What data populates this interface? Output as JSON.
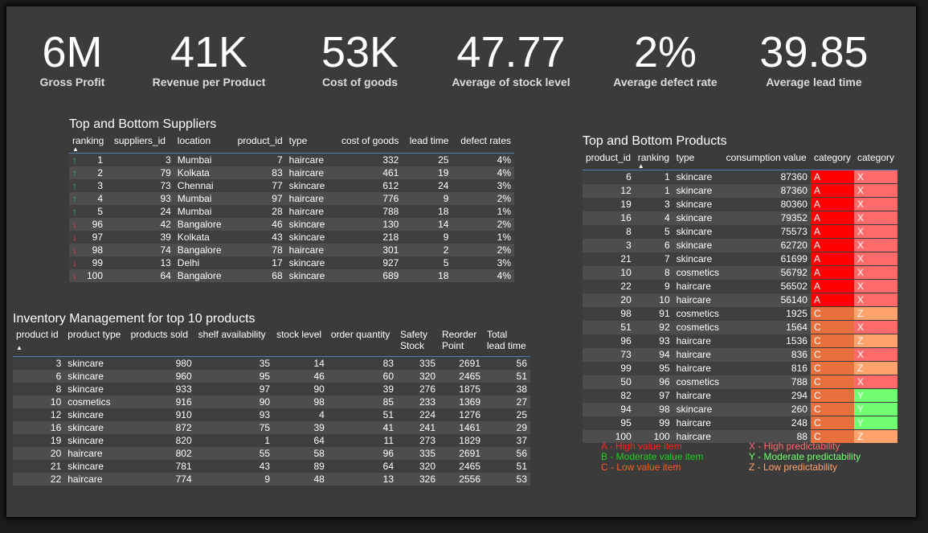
{
  "kpis": [
    {
      "value": "6M",
      "label": "Gross Profit"
    },
    {
      "value": "41K",
      "label": "Revenue per Product"
    },
    {
      "value": "53K",
      "label": "Cost of goods"
    },
    {
      "value": "47.77",
      "label": "Average of stock level"
    },
    {
      "value": "2%",
      "label": "Average defect rate"
    },
    {
      "value": "39.85",
      "label": "Average lead time"
    }
  ],
  "suppliers": {
    "title": "Top and Bottom Suppliers",
    "columns": [
      "ranking",
      "suppliers_id",
      "location",
      "product_id",
      "type",
      "cost of goods",
      "lead time",
      "defect rates"
    ],
    "rows": [
      {
        "dir": "up",
        "ranking": "1",
        "supplier": "3",
        "location": "Mumbai",
        "product": "7",
        "type": "haircare",
        "cost": "332",
        "lead": "25",
        "defect": "4%"
      },
      {
        "dir": "up",
        "ranking": "2",
        "supplier": "79",
        "location": "Kolkata",
        "product": "83",
        "type": "haircare",
        "cost": "461",
        "lead": "19",
        "defect": "4%"
      },
      {
        "dir": "up",
        "ranking": "3",
        "supplier": "73",
        "location": "Chennai",
        "product": "77",
        "type": "skincare",
        "cost": "612",
        "lead": "24",
        "defect": "3%"
      },
      {
        "dir": "up",
        "ranking": "4",
        "supplier": "93",
        "location": "Mumbai",
        "product": "97",
        "type": "haircare",
        "cost": "776",
        "lead": "9",
        "defect": "2%"
      },
      {
        "dir": "up",
        "ranking": "5",
        "supplier": "24",
        "location": "Mumbai",
        "product": "28",
        "type": "haircare",
        "cost": "788",
        "lead": "18",
        "defect": "1%"
      },
      {
        "dir": "down",
        "ranking": "96",
        "supplier": "42",
        "location": "Bangalore",
        "product": "46",
        "type": "skincare",
        "cost": "130",
        "lead": "14",
        "defect": "2%"
      },
      {
        "dir": "down",
        "ranking": "97",
        "supplier": "39",
        "location": "Kolkata",
        "product": "43",
        "type": "skincare",
        "cost": "218",
        "lead": "9",
        "defect": "1%"
      },
      {
        "dir": "down",
        "ranking": "98",
        "supplier": "74",
        "location": "Bangalore",
        "product": "78",
        "type": "haircare",
        "cost": "301",
        "lead": "2",
        "defect": "2%"
      },
      {
        "dir": "down",
        "ranking": "99",
        "supplier": "13",
        "location": "Delhi",
        "product": "17",
        "type": "skincare",
        "cost": "927",
        "lead": "5",
        "defect": "3%"
      },
      {
        "dir": "down",
        "ranking": "100",
        "supplier": "64",
        "location": "Bangalore",
        "product": "68",
        "type": "skincare",
        "cost": "689",
        "lead": "18",
        "defect": "4%"
      }
    ]
  },
  "inventory": {
    "title": "Inventory Management for top 10 products",
    "columns": [
      "product id",
      "product type",
      "products sold",
      "shelf availability",
      "stock level",
      "order quantity",
      "Safety Stock",
      "Reorder Point",
      "Total lead time"
    ],
    "rows": [
      [
        "3",
        "skincare",
        "980",
        "35",
        "14",
        "83",
        "335",
        "2691",
        "56"
      ],
      [
        "6",
        "skincare",
        "960",
        "95",
        "46",
        "60",
        "320",
        "2465",
        "51"
      ],
      [
        "8",
        "skincare",
        "933",
        "97",
        "90",
        "39",
        "276",
        "1875",
        "38"
      ],
      [
        "10",
        "cosmetics",
        "916",
        "90",
        "98",
        "85",
        "233",
        "1369",
        "27"
      ],
      [
        "12",
        "skincare",
        "910",
        "93",
        "4",
        "51",
        "224",
        "1276",
        "25"
      ],
      [
        "16",
        "skincare",
        "872",
        "75",
        "39",
        "41",
        "241",
        "1461",
        "29"
      ],
      [
        "19",
        "skincare",
        "820",
        "1",
        "64",
        "11",
        "273",
        "1829",
        "37"
      ],
      [
        "20",
        "haircare",
        "802",
        "55",
        "58",
        "96",
        "335",
        "2691",
        "56"
      ],
      [
        "21",
        "skincare",
        "781",
        "43",
        "89",
        "64",
        "320",
        "2465",
        "51"
      ],
      [
        "22",
        "haircare",
        "774",
        "9",
        "48",
        "13",
        "326",
        "2556",
        "53"
      ]
    ]
  },
  "products": {
    "title": "Top and Bottom Products",
    "columns": [
      "product_id",
      "ranking",
      "type",
      "consumption value",
      "category",
      "category"
    ],
    "rows": [
      [
        "6",
        "1",
        "skincare",
        "87360",
        "A",
        "X"
      ],
      [
        "12",
        "1",
        "skincare",
        "87360",
        "A",
        "X"
      ],
      [
        "19",
        "3",
        "skincare",
        "80360",
        "A",
        "X"
      ],
      [
        "16",
        "4",
        "skincare",
        "79352",
        "A",
        "X"
      ],
      [
        "8",
        "5",
        "skincare",
        "75573",
        "A",
        "X"
      ],
      [
        "3",
        "6",
        "skincare",
        "62720",
        "A",
        "X"
      ],
      [
        "21",
        "7",
        "skincare",
        "61699",
        "A",
        "X"
      ],
      [
        "10",
        "8",
        "cosmetics",
        "56792",
        "A",
        "X"
      ],
      [
        "22",
        "9",
        "haircare",
        "56502",
        "A",
        "X"
      ],
      [
        "20",
        "10",
        "haircare",
        "56140",
        "A",
        "X"
      ],
      [
        "98",
        "91",
        "cosmetics",
        "1925",
        "C",
        "Z"
      ],
      [
        "51",
        "92",
        "cosmetics",
        "1564",
        "C",
        "X"
      ],
      [
        "96",
        "93",
        "haircare",
        "1536",
        "C",
        "Z"
      ],
      [
        "73",
        "94",
        "haircare",
        "836",
        "C",
        "X"
      ],
      [
        "99",
        "95",
        "haircare",
        "816",
        "C",
        "Z"
      ],
      [
        "50",
        "96",
        "cosmetics",
        "788",
        "C",
        "X"
      ],
      [
        "82",
        "97",
        "haircare",
        "294",
        "C",
        "Y"
      ],
      [
        "94",
        "98",
        "skincare",
        "260",
        "C",
        "Y"
      ],
      [
        "95",
        "99",
        "haircare",
        "248",
        "C",
        "Y"
      ],
      [
        "100",
        "100",
        "haircare",
        "88",
        "C",
        "Z"
      ]
    ]
  },
  "legend_left": [
    {
      "text": "A - High value item",
      "color": "#ff2020"
    },
    {
      "text": "B - Moderate value item",
      "color": "#22cc22"
    },
    {
      "text": "C - Low value item",
      "color": "#ff5a1e"
    }
  ],
  "legend_right": [
    {
      "text": "X - High predictability",
      "color": "#ff6b6b"
    },
    {
      "text": "Y - Moderate predictability",
      "color": "#70ff70"
    },
    {
      "text": "Z - Low predictability",
      "color": "#ffa26b"
    }
  ],
  "icons": {
    "up": "arrow-up-icon",
    "down": "arrow-down-icon",
    "sort": "sort-ascending-icon"
  }
}
